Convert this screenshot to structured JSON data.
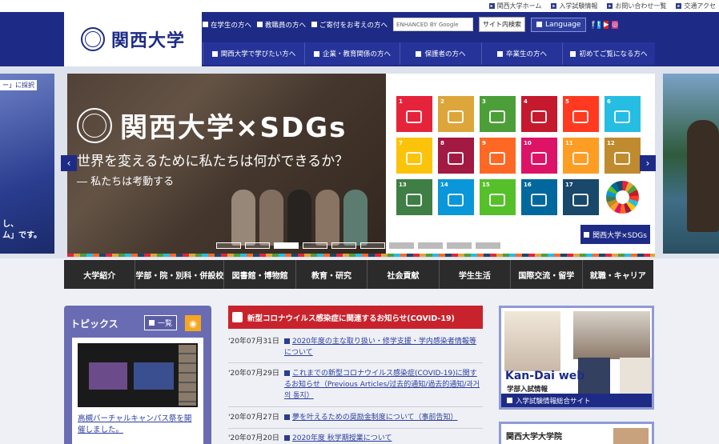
{
  "utility": {
    "links": [
      "関西大学ホーム",
      "入学試験情報",
      "お問い合わせ一覧",
      "交通アクセ"
    ]
  },
  "header": {
    "logo_text": "関西大学",
    "row1_links": [
      "在学生の方へ",
      "教職員の方へ",
      "ご寄付をお考えの方へ"
    ],
    "search_placeholder": "ENHANCED BY Google",
    "site_search_label": "サイト内検索",
    "language_label": "Language",
    "sns": [
      "f",
      "t",
      "▶",
      "◎"
    ],
    "row2_tabs": [
      "関西大学で学びたい方へ",
      "企業・教育関係の方へ",
      "保護者の方へ",
      "卒業生の方へ",
      "初めてご覧になる方へ"
    ]
  },
  "hero": {
    "left_peek_top": "ー」に採択",
    "left_peek_bottom_1": "し、",
    "left_peek_bottom_2": "ム」です。",
    "title": "関西大学×SDGs",
    "subtitle": "世界を変えるために私たちは何ができるか？",
    "tagline": "― 私たちは考動する",
    "sdg_link": "関西大学×SDGs",
    "prev_label": "‹",
    "next_label": "›",
    "goals": [
      {
        "num": "1",
        "color": "#e5243b"
      },
      {
        "num": "2",
        "color": "#dda63a"
      },
      {
        "num": "3",
        "color": "#4c9f38"
      },
      {
        "num": "4",
        "color": "#c5192d"
      },
      {
        "num": "5",
        "color": "#ff3a21"
      },
      {
        "num": "6",
        "color": "#26bde2"
      },
      {
        "num": "7",
        "color": "#fcc30b"
      },
      {
        "num": "8",
        "color": "#a21942"
      },
      {
        "num": "9",
        "color": "#fd6925"
      },
      {
        "num": "10",
        "color": "#dd1367"
      },
      {
        "num": "11",
        "color": "#fd9d24"
      },
      {
        "num": "12",
        "color": "#bf8b2e"
      },
      {
        "num": "13",
        "color": "#3f7e44"
      },
      {
        "num": "14",
        "color": "#0a97d9"
      },
      {
        "num": "15",
        "color": "#56c02b"
      },
      {
        "num": "16",
        "color": "#00689d"
      },
      {
        "num": "17",
        "color": "#19486a"
      }
    ]
  },
  "global_nav": [
    "大学紹介",
    "学部・院・別科・併設校",
    "図書館・博物館",
    "教育・研究",
    "社会貢献",
    "学生生活",
    "国際交流・留学",
    "就職・キャリア"
  ],
  "topics": {
    "title": "トピックス",
    "more_label": "一覧",
    "caption": "高槻バーチャルキャンパス祭を開催しました。"
  },
  "news": {
    "header": "新型コロナウイルス感染症に関連するお知らせ(COVID-19)",
    "items": [
      {
        "date": "'20年07月31日",
        "title": "2020年度の主な取り扱い・修学支援・学内感染者情報等について"
      },
      {
        "date": "'20年07月29日",
        "title": "これまでの新型コロナウイルス感染症(COVID-19)に関するお知らせ（Previous Articles/过去的通知/過去的通知/과거의 통지）"
      },
      {
        "date": "'20年07月27日",
        "title": "夢を叶えるための奨励金制度について（事前告知）"
      },
      {
        "date": "'20年07月20日",
        "title": "2020年度 秋学期授業について"
      }
    ]
  },
  "kandai": {
    "title": "Kan-Dai web",
    "subtitle": "学部入試情報",
    "link": "入学試験情報総合サイト"
  },
  "grad": {
    "title": "関西大学大学院"
  }
}
